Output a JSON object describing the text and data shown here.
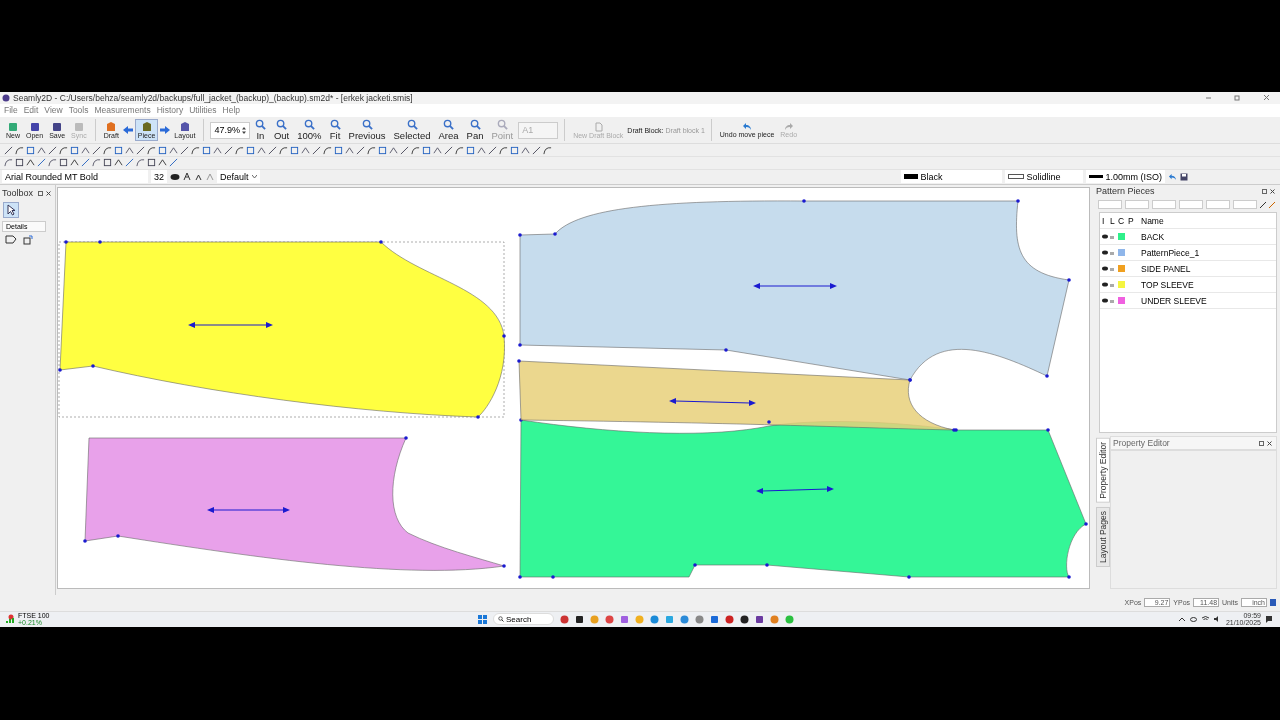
{
  "window": {
    "title": "Seamly2D - C:/Users/behza/seamly2d/backups/full_jacket_(backup)_(backup).sm2d* - [erkek jacketi.smis]"
  },
  "menu": [
    "File",
    "Edit",
    "View",
    "Tools",
    "Measurements",
    "History",
    "Utilities",
    "Help"
  ],
  "toolbar": {
    "file_buttons": [
      {
        "label": "New",
        "disabled": false
      },
      {
        "label": "Open",
        "disabled": false
      },
      {
        "label": "Save",
        "disabled": false
      },
      {
        "label": "Sync",
        "disabled": true
      }
    ],
    "mode_buttons": [
      {
        "label": "Draft",
        "selected": false
      },
      {
        "label": "Piece",
        "selected": true
      },
      {
        "label": "Layout",
        "selected": false
      }
    ],
    "zoom": "47.9%",
    "zoom_buttons": [
      {
        "label": "In",
        "disabled": false
      },
      {
        "label": "Out",
        "disabled": false
      },
      {
        "label": "100%",
        "disabled": false
      },
      {
        "label": "Fit",
        "disabled": false
      },
      {
        "label": "Previous",
        "disabled": false
      },
      {
        "label": "Selected",
        "disabled": false
      },
      {
        "label": "Area",
        "disabled": false
      },
      {
        "label": "Pan",
        "disabled": false
      },
      {
        "label": "Point",
        "disabled": true
      }
    ],
    "page_size": "A1",
    "new_draft_block": "New Draft Block",
    "draft_block_label": "Draft Block:",
    "draft_block": "Draft block 1",
    "undo": "Undo move piece",
    "redo": "Redo"
  },
  "font_bar": {
    "font": "Arial Rounded MT Bold",
    "size": "32",
    "style": "Default"
  },
  "line_bar": {
    "stroke_name": "Black",
    "line_type": "Solidline",
    "line_weight": "1.00mm (ISO)"
  },
  "toolbox": {
    "title": "Toolbox",
    "details": "Details"
  },
  "pattern_pieces": {
    "title": "Pattern Pieces",
    "columns": [
      "I",
      "L",
      "C",
      "P",
      "Name"
    ],
    "rows": [
      {
        "name": "BACK",
        "color": "#2ef08a"
      },
      {
        "name": "PatternPiece_1",
        "color": "#8fb6ea"
      },
      {
        "name": "SIDE PANEL",
        "color": "#f0a020"
      },
      {
        "name": "TOP SLEEVE",
        "color": "#f5f540"
      },
      {
        "name": "UNDER SLEEVE",
        "color": "#f060e0"
      }
    ]
  },
  "property_editor": {
    "title": "Property Editor",
    "tabs": [
      {
        "label": "Property Editor",
        "selected": true
      },
      {
        "label": "Layout Pages",
        "selected": false
      }
    ]
  },
  "status_bar": {
    "xpos_label": "XPos",
    "xpos": "9.27",
    "ypos_label": "YPos",
    "ypos": "11.48",
    "units_label": "Units",
    "units": "inch"
  },
  "taskbar": {
    "widget_title": "FTSE 100",
    "widget_value": "+0.21%",
    "search": "Search",
    "time": "09:59",
    "date": "21/10/2025"
  }
}
